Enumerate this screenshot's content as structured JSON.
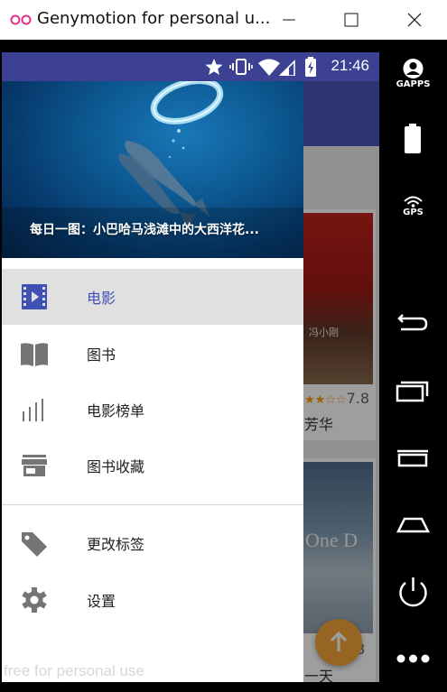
{
  "window": {
    "title": "Genymotion for personal u...",
    "minimize_icon": "minimize-icon",
    "maximize_icon": "maximize-icon",
    "close_icon": "close-icon"
  },
  "statusbar": {
    "time": "21:46",
    "icons": [
      "star-icon",
      "vibrate-icon",
      "wifi-icon",
      "signal-icon",
      "battery-charging-icon"
    ]
  },
  "drawer": {
    "header_caption": "每日一图：小巴哈马浅滩中的大西洋花...",
    "items": [
      {
        "label": "电影",
        "icon": "movie-film-icon",
        "active": true
      },
      {
        "label": "图书",
        "icon": "book-icon",
        "active": false
      },
      {
        "label": "电影榜单",
        "icon": "bar-chart-icon",
        "active": false
      },
      {
        "label": "图书收藏",
        "icon": "store-icon",
        "active": false
      },
      {
        "label": "更改标签",
        "icon": "tag-icon",
        "active": false
      },
      {
        "label": "设置",
        "icon": "settings-gear-icon",
        "active": false
      }
    ]
  },
  "background_app": {
    "card1": {
      "rating": "7.8",
      "subtitle": "芳华",
      "poster_text": "冯小刚"
    },
    "card2": {
      "rating": "8",
      "subtitle": "一天",
      "poster_text": "One D"
    }
  },
  "watermark": "free for personal use",
  "genymotion_sidebar": {
    "gapps_label": "GAPPS",
    "gps_label": "GPS",
    "buttons": [
      "gapps-icon",
      "battery-icon",
      "gps-icon",
      "back-icon",
      "recent-apps-icon",
      "menu-icon",
      "home-icon",
      "power-icon",
      "more-icon"
    ]
  },
  "colors": {
    "statusbar": "#3c4193",
    "active_text": "#3f51b5",
    "fab": "#f2a33a"
  }
}
